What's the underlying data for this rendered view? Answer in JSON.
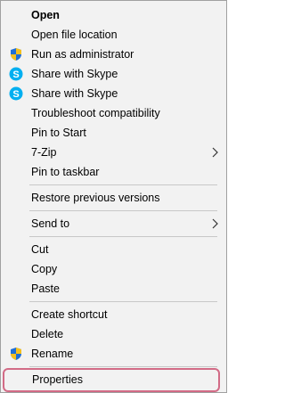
{
  "menu": {
    "items": [
      {
        "label": "Open"
      },
      {
        "label": "Open file location"
      },
      {
        "label": "Run as administrator",
        "icon": "uac-shield-icon"
      },
      {
        "label": "Share with Skype",
        "icon": "skype-icon"
      },
      {
        "label": "Share with Skype",
        "icon": "skype-icon"
      },
      {
        "label": "Troubleshoot compatibility"
      },
      {
        "label": "Pin to Start"
      },
      {
        "label": "7-Zip",
        "submenu": true
      },
      {
        "label": "Pin to taskbar"
      },
      {
        "label": "Restore previous versions"
      },
      {
        "label": "Send to",
        "submenu": true
      },
      {
        "label": "Cut"
      },
      {
        "label": "Copy"
      },
      {
        "label": "Paste"
      },
      {
        "label": "Create shortcut"
      },
      {
        "label": "Delete"
      },
      {
        "label": "Rename",
        "icon": "uac-shield-icon"
      },
      {
        "label": "Properties",
        "highlighted": true
      }
    ]
  },
  "colors": {
    "background": "#f2f2f2",
    "separator": "#c8c8c8",
    "highlight_outline": "#d26b86",
    "skype": "#00aff0",
    "shield_blue": "#1f6fd6",
    "shield_yellow": "#f4c01e"
  }
}
